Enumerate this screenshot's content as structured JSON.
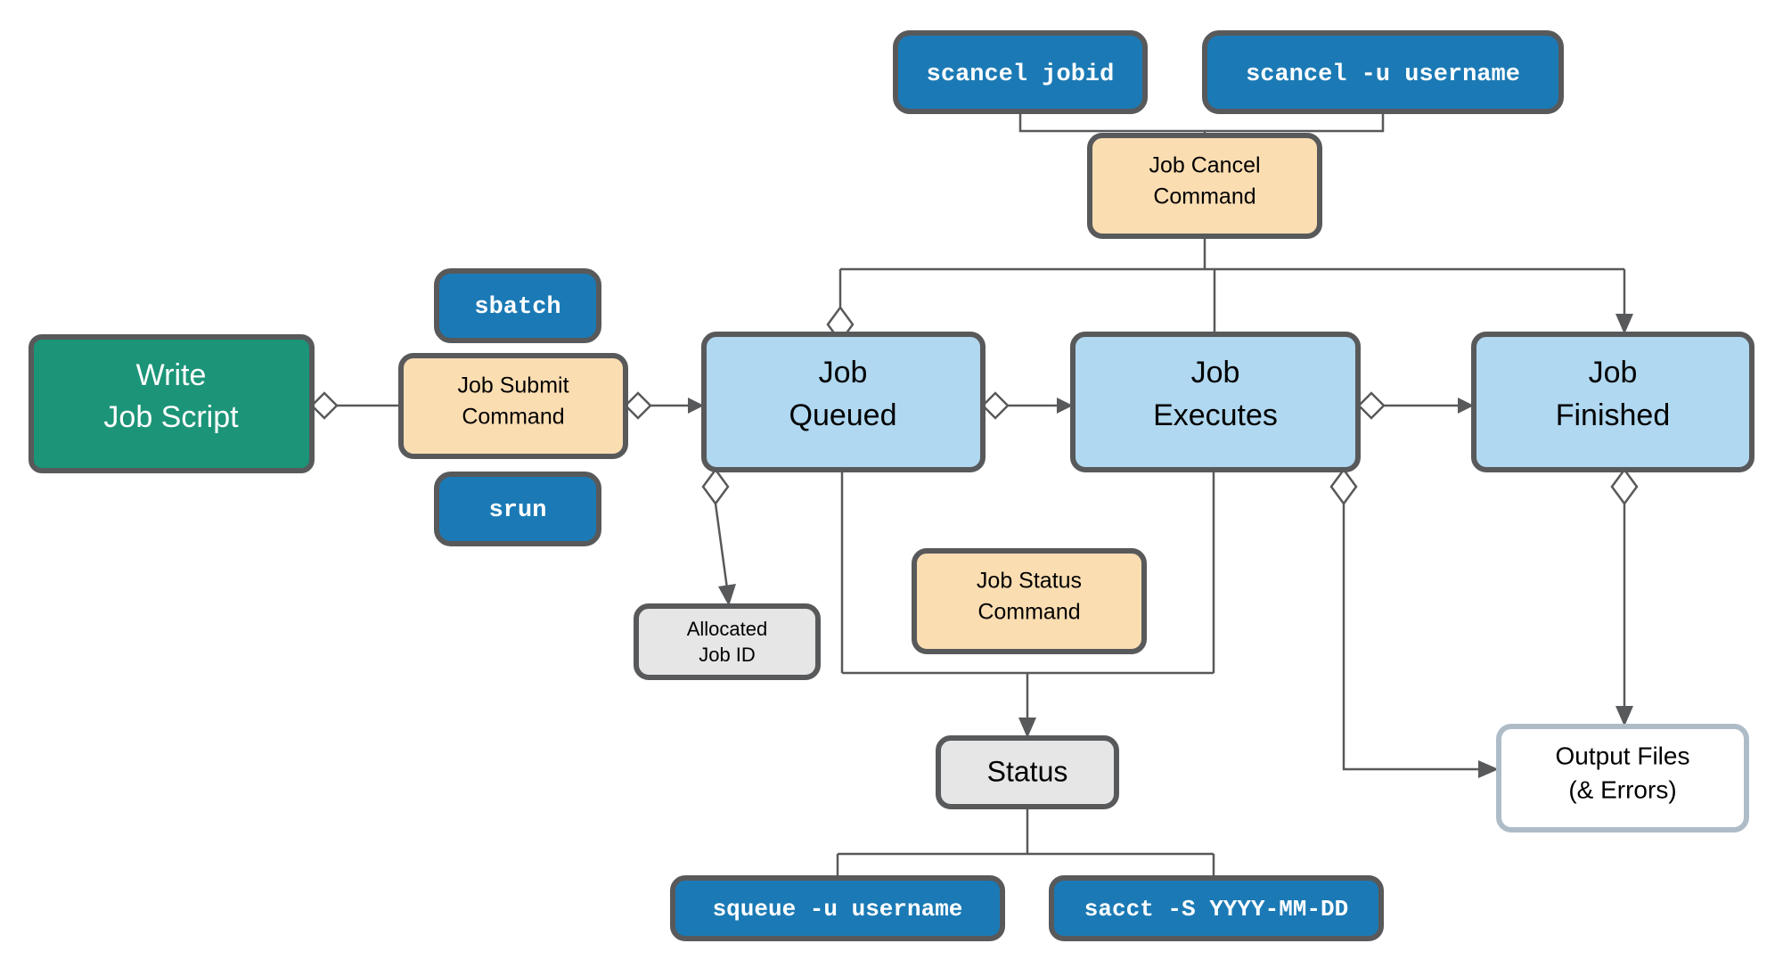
{
  "diagram": {
    "title": "Slurm Job Lifecycle Flowchart",
    "colors": {
      "blue_command_fill": "#1b7ab5",
      "blue_command_stroke": "#58595b",
      "peach_fill": "#fbddb2",
      "peach_stroke": "#58595b",
      "lightblue_fill": "#b0d8f0",
      "lightblue_stroke": "#58595b",
      "green_fill": "#1c9478",
      "green_stroke": "#58595b",
      "gray_fill": "#e6e6e6",
      "gray_stroke": "#58595b",
      "white_fill": "#ffffff",
      "white_stroke": "#aebcc8",
      "edge": "#58595b",
      "text_dark": "#000000",
      "text_light": "#ffffff"
    },
    "nodes": [
      {
        "id": "scancel-jobid",
        "kind": "command",
        "text": "scancel jobid",
        "lines": [
          "scancel jobid"
        ]
      },
      {
        "id": "scancel-user",
        "kind": "command",
        "text": "scancel -u username",
        "lines": [
          "scancel -u username"
        ]
      },
      {
        "id": "job-cancel-command",
        "kind": "action",
        "text": "Job Cancel Command",
        "lines": [
          "Job Cancel",
          "Command"
        ]
      },
      {
        "id": "sbatch",
        "kind": "command",
        "text": "sbatch",
        "lines": [
          "sbatch"
        ]
      },
      {
        "id": "srun",
        "kind": "command",
        "text": "srun",
        "lines": [
          "srun"
        ]
      },
      {
        "id": "write-job-script",
        "kind": "start",
        "text": "Write Job Script",
        "lines": [
          "Write",
          "Job Script"
        ]
      },
      {
        "id": "job-submit-command",
        "kind": "action",
        "text": "Job Submit Command",
        "lines": [
          "Job Submit",
          "Command"
        ]
      },
      {
        "id": "job-queued",
        "kind": "state",
        "text": "Job Queued",
        "lines": [
          "Job",
          "Queued"
        ]
      },
      {
        "id": "job-executes",
        "kind": "state",
        "text": "Job Executes",
        "lines": [
          "Job",
          "Executes"
        ]
      },
      {
        "id": "job-finished",
        "kind": "state",
        "text": "Job Finished",
        "lines": [
          "Job",
          "Finished"
        ]
      },
      {
        "id": "allocated-job-id",
        "kind": "artifact",
        "text": "Allocated Job ID",
        "lines": [
          "Allocated",
          "Job ID"
        ]
      },
      {
        "id": "job-status-command",
        "kind": "action",
        "text": "Job Status Command",
        "lines": [
          "Job Status",
          "Command"
        ]
      },
      {
        "id": "status",
        "kind": "artifact",
        "text": "Status",
        "lines": [
          "Status"
        ]
      },
      {
        "id": "squeue",
        "kind": "command",
        "text": "squeue -u username",
        "lines": [
          "squeue -u username"
        ]
      },
      {
        "id": "sacct",
        "kind": "command",
        "text": "sacct -S YYYY-MM-DD",
        "lines": [
          "sacct -S YYYY-MM-DD"
        ]
      },
      {
        "id": "output-files",
        "kind": "output",
        "text": "Output Files (& Errors)",
        "lines": [
          "Output Files",
          "(& Errors)"
        ]
      }
    ]
  }
}
